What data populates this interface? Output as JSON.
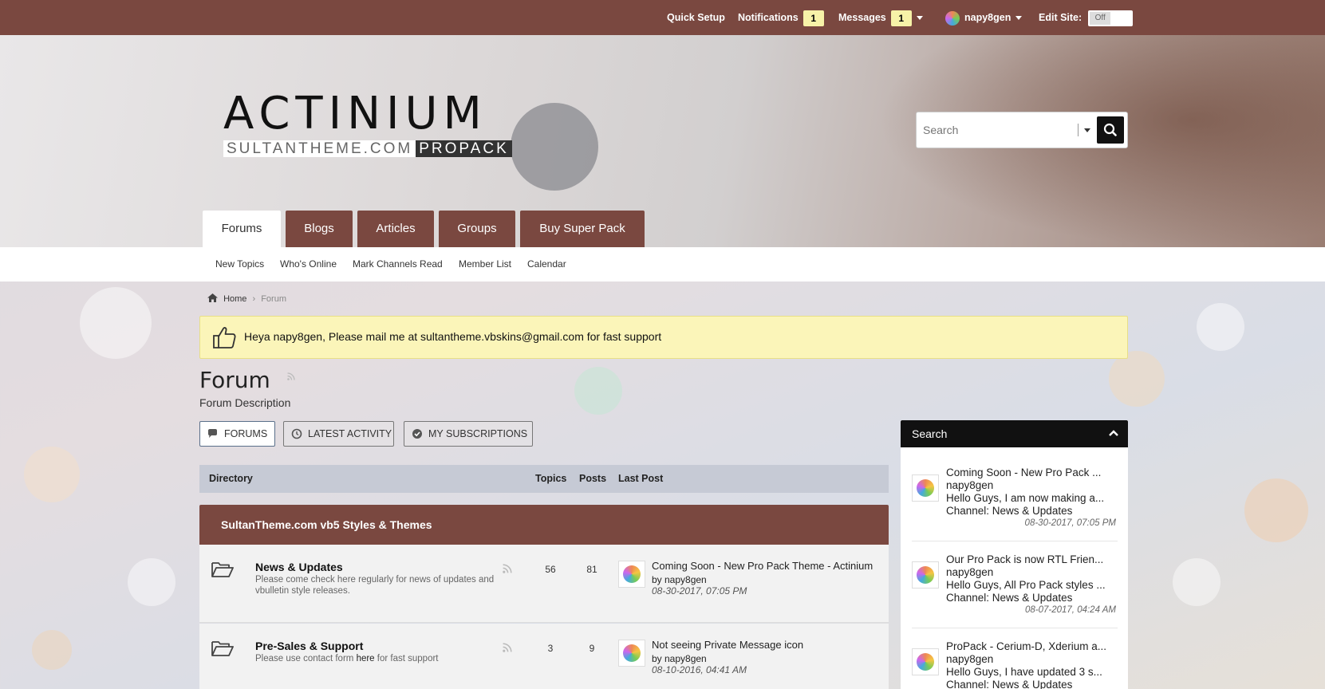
{
  "topbar": {
    "quick_setup": "Quick Setup",
    "notifications_label": "Notifications",
    "notifications_count": "1",
    "messages_label": "Messages",
    "messages_count": "1",
    "username": "napy8gen",
    "edit_site_label": "Edit Site:",
    "edit_site_toggle": "Off"
  },
  "logo": {
    "main": "ACTINIUM",
    "sub_a": "SULTANTHEME.COM",
    "sub_b": "PROPACK"
  },
  "header_search": {
    "placeholder": "Search"
  },
  "nav_tabs": [
    "Forums",
    "Blogs",
    "Articles",
    "Groups",
    "Buy Super Pack"
  ],
  "subnav": [
    "New Topics",
    "Who's Online",
    "Mark Channels Read",
    "Member List",
    "Calendar"
  ],
  "breadcrumb": {
    "home": "Home",
    "current": "Forum"
  },
  "notice": "Heya napy8gen, Please mail me at sultantheme.vbskins@gmail.com for fast support",
  "page": {
    "title": "Forum",
    "description": "Forum Description"
  },
  "view_tabs": [
    "FORUMS",
    "LATEST ACTIVITY",
    "MY SUBSCRIPTIONS"
  ],
  "table_header": {
    "directory": "Directory",
    "topics": "Topics",
    "posts": "Posts",
    "last_post": "Last Post"
  },
  "category": "SultanTheme.com vb5 Styles & Themes",
  "forums": [
    {
      "title": "News & Updates",
      "desc": "Please come check here regularly for news of updates and vbulletin style releases.",
      "topics": "56",
      "posts": "81",
      "last_title": "Coming Soon - New Pro Pack Theme - Actinium",
      "last_by": "by napy8gen",
      "last_date": "08-30-2017, 07:05 PM"
    },
    {
      "title": "Pre-Sales & Support",
      "desc_before": "Please use contact form ",
      "desc_link": "here",
      "desc_after": " for fast support",
      "topics": "3",
      "posts": "9",
      "last_title": "Not seeing Private Message icon",
      "last_by": "by napy8gen",
      "last_date": "08-10-2016, 04:41 AM"
    }
  ],
  "sidebar": {
    "title": "Search",
    "items": [
      {
        "title": "Coming Soon - New Pro Pack ...",
        "user": "napy8gen",
        "excerpt": "Hello Guys, I am now making a...",
        "channel": "Channel: News & Updates",
        "date": "08-30-2017, 07:05 PM"
      },
      {
        "title": "Our Pro Pack is now RTL Frien...",
        "user": "napy8gen",
        "excerpt": "Hello Guys, All Pro Pack styles ...",
        "channel": "Channel: News & Updates",
        "date": "08-07-2017, 04:24 AM"
      },
      {
        "title": "ProPack - Cerium-D, Xderium a...",
        "user": "napy8gen",
        "excerpt": "Hello Guys, I have updated 3 s...",
        "channel": "Channel: News & Updates",
        "date": ""
      }
    ]
  },
  "colors": {
    "brand": "#7a4840",
    "notice_bg": "#fbf5b9",
    "table_header": "#c6cad5",
    "sidebar_header": "#111111"
  }
}
